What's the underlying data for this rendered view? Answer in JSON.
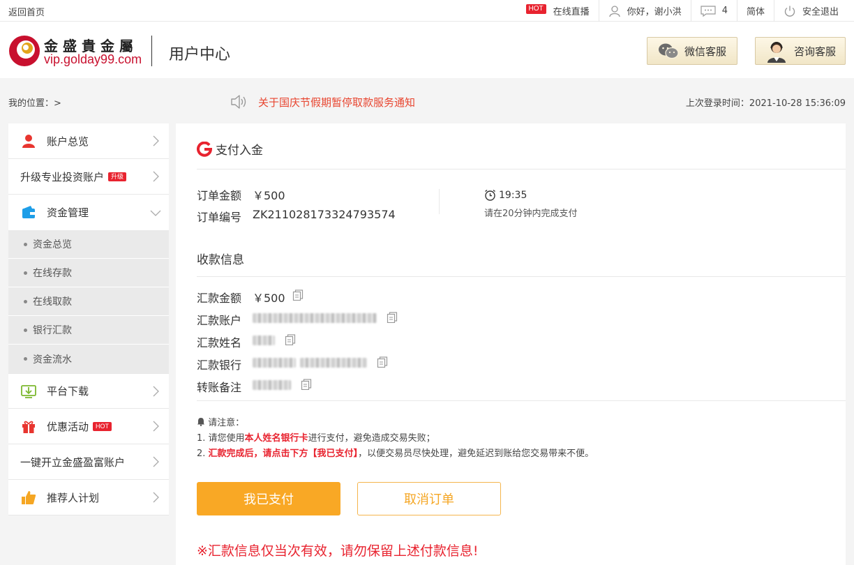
{
  "topbar": {
    "home": "返回首页",
    "live_tag": "HOT",
    "live": "在线直播",
    "greeting": "你好，谢小洪",
    "message_count": "4",
    "language": "简体",
    "logout": "安全退出"
  },
  "header": {
    "brand_cn": "金盛貴金屬",
    "brand_url": "vip.golday99.com",
    "center_title": "用户中心",
    "wechat_service": "微信客服",
    "consult_service": "咨询客服"
  },
  "notice_bar": {
    "location": "我的位置：>",
    "notice": "关于国庆节假期暂停取款服务通知",
    "last_login": "上次登录时间：2021-10-28 15:36:09"
  },
  "sidebar": {
    "items": [
      {
        "label": "账户总览"
      },
      {
        "label": "升级专业投资账户",
        "tag": "升级"
      },
      {
        "label": "资金管理"
      },
      {
        "label": "平台下载"
      },
      {
        "label": "优惠活动",
        "tag": "HOT"
      },
      {
        "label": "一键开立金盛盈富账户"
      },
      {
        "label": "推荐人计划"
      }
    ],
    "sub_items": [
      "资金总览",
      "在线存款",
      "在线取款",
      "银行汇款",
      "资金流水"
    ]
  },
  "payment": {
    "title": "支付入金",
    "order_amount_label": "订单金额",
    "order_amount": "￥500",
    "order_no_label": "订单编号",
    "order_no": "ZK211028173324793574",
    "timer": "19:35",
    "timer_hint": "请在20分钟内完成支付",
    "receive_title": "收款信息",
    "remit_amount_label": "汇款金额",
    "remit_amount": "￥500",
    "remit_account_label": "汇款账户",
    "remit_name_label": "汇款姓名",
    "remit_bank_label": "汇款银行",
    "remark_label": "转账备注",
    "notes_title": "请注意：",
    "note1_a": "1. 请您使用",
    "note1_b": "本人姓名银行卡",
    "note1_c": "进行支付，避免造成交易失败；",
    "note2_a": "2. ",
    "note2_b": "汇款完成后，请点击下方【我已支付】",
    "note2_c": "，以便交易员尽快处理，避免延迟到账给您交易带来不便。",
    "paid_button": "我已支付",
    "cancel_button": "取消订单",
    "warning": "※汇款信息仅当次有效，请勿保留上述付款信息!"
  }
}
